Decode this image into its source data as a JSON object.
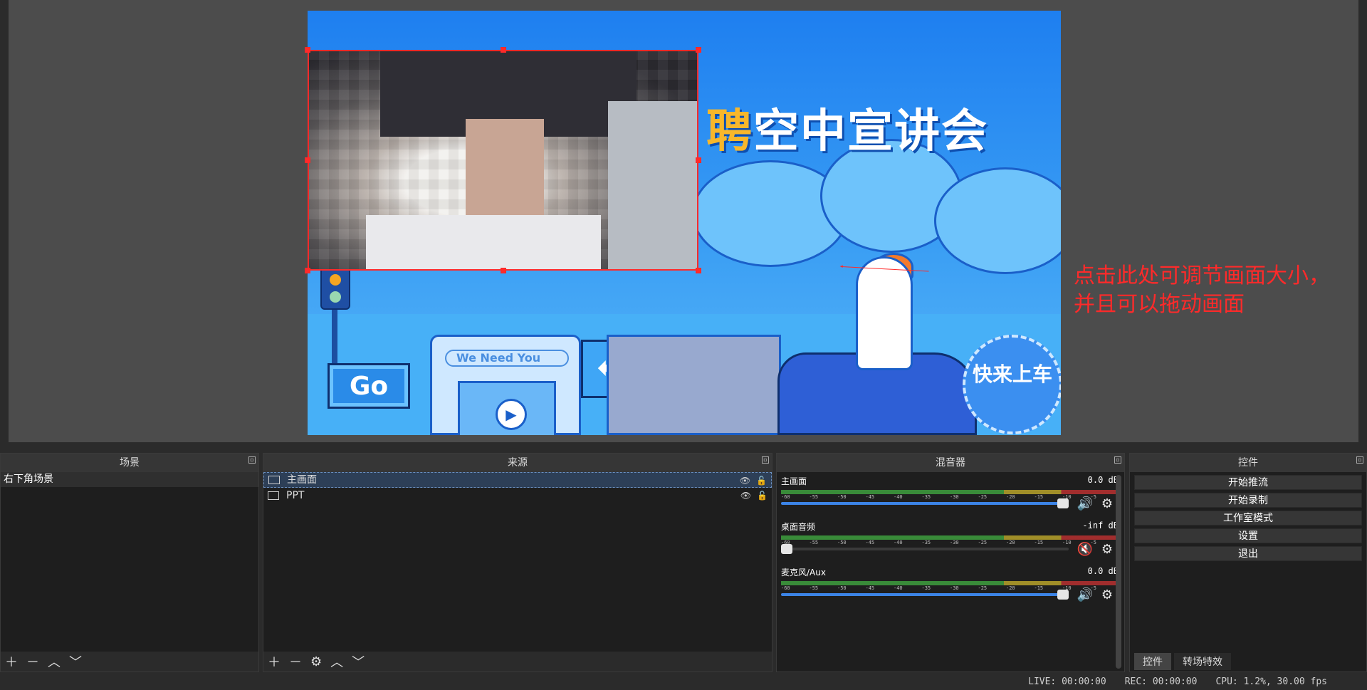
{
  "preview": {
    "canvas": {
      "title_prefix": "聘",
      "title": "空中宣讲会",
      "go_label": "Go",
      "search_placeholder": "We Need You",
      "badge_text": "快来上车"
    },
    "annotation": {
      "text": "点击此处可调节画面大小，并且可以拖动画面",
      "color": "#ff2a2a"
    }
  },
  "docks": {
    "scenes": {
      "title": "场景",
      "items": [
        {
          "label": "右下角场景",
          "selected": true
        }
      ]
    },
    "sources": {
      "title": "来源",
      "items": [
        {
          "label": "主画面",
          "icon": "camera-icon",
          "visible": true,
          "locked": false,
          "selected": true
        },
        {
          "label": "PPT",
          "icon": "window-capture-icon",
          "visible": true,
          "locked": false,
          "selected": false
        }
      ]
    },
    "mixer": {
      "title": "混音器",
      "scale": [
        "-60",
        "-55",
        "-50",
        "-45",
        "-40",
        "-35",
        "-30",
        "-25",
        "-20",
        "-15",
        "-10",
        "-5",
        "0"
      ],
      "channels": [
        {
          "name": "主画面",
          "db": "0.0 dB",
          "volume": 1.0,
          "muted": false
        },
        {
          "name": "桌面音频",
          "db": "-inf dB",
          "volume": 0.0,
          "muted": true
        },
        {
          "name": "麦克风/Aux",
          "db": "0.0 dB",
          "volume": 1.0,
          "muted": false
        }
      ]
    },
    "controls": {
      "title": "控件",
      "buttons": [
        "开始推流",
        "开始录制",
        "工作室模式",
        "设置",
        "退出"
      ],
      "tabs": [
        "控件",
        "转场特效"
      ]
    }
  },
  "statusbar": {
    "live": "LIVE: 00:00:00",
    "rec": "REC: 00:00:00",
    "cpu": "CPU: 1.2%, 30.00 fps"
  },
  "colors": {
    "accent_blue": "#3c84e6",
    "selection": "#ff2a2a"
  }
}
